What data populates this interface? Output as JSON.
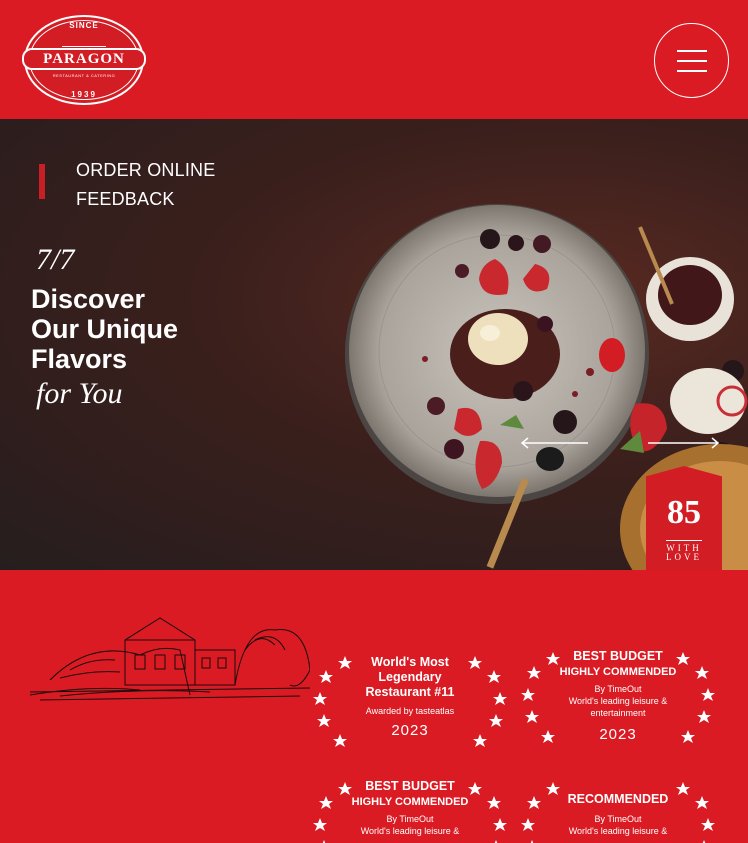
{
  "brand": {
    "since": "SINCE",
    "name": "PARAGON",
    "subtitle": "RESTAURANT & CATERING",
    "year": "1939"
  },
  "header": {
    "menu_icon": "hamburger-menu-icon"
  },
  "hero": {
    "links": [
      "ORDER ONLINE",
      "FEEDBACK"
    ],
    "tag": "7/7",
    "title_lines": [
      "Discover",
      "Our Unique",
      "Flavors"
    ],
    "script": "for You",
    "badge": {
      "number": "85",
      "line1": "WITH",
      "line2": "LOVE"
    },
    "prev_icon": "arrow-left-icon",
    "next_icon": "arrow-right-icon",
    "colors": {
      "accent": "#da1b24",
      "bg": "#261e1e"
    }
  },
  "awards": [
    {
      "lines": [
        "World's Most",
        "Legendary",
        "Restaurant #11"
      ],
      "by": "Awarded by tasteatlas",
      "detail": "",
      "detail2": "",
      "year": "2023"
    },
    {
      "lines": [
        "BEST BUDGET",
        "HIGHLY COMMENDED"
      ],
      "by": "By TimeOut",
      "detail": "World's leading leisure &",
      "detail2": "entertainment",
      "year": "2023"
    },
    {
      "lines": [
        "BEST BUDGET",
        "HIGHLY COMMENDED"
      ],
      "by": "By TimeOut",
      "detail": "World's leading leisure &",
      "detail2": "",
      "year": ""
    },
    {
      "lines": [
        "RECOMMENDED"
      ],
      "by": "By TimeOut",
      "detail": "World's leading leisure &",
      "detail2": "",
      "year": ""
    }
  ]
}
